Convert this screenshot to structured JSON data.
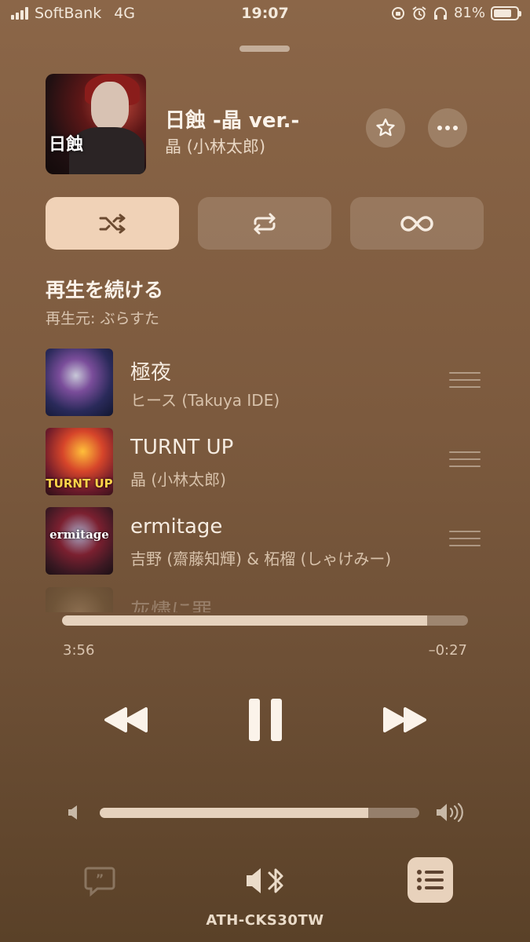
{
  "status_bar": {
    "carrier": "SoftBank",
    "network": "4G",
    "time": "19:07",
    "battery": "81%",
    "battery_level": 0.81
  },
  "now_playing": {
    "art_text": "日蝕",
    "title": "日蝕 -晶 ver.-",
    "artist": "晶 (小林太郎)"
  },
  "modes": {
    "shuffle_active": true,
    "repeat_active": false,
    "autoplay_active": false
  },
  "queue": {
    "heading": "再生を続ける",
    "source": "再生元: ぶらすた",
    "items": [
      {
        "title": "極夜",
        "artist": "ヒース (Takuya IDE)",
        "art_text": ""
      },
      {
        "title": "TURNT UP",
        "artist": "晶 (小林太郎)",
        "art_text": "TURNT UP"
      },
      {
        "title": "ermitage",
        "artist": "吉野 (齋藤知輝) & 柘榴 (しゃけみー)",
        "art_text": "ermitage"
      },
      {
        "title": "灰燼に罪",
        "artist": "",
        "art_text": ""
      }
    ]
  },
  "playback": {
    "elapsed": "3:56",
    "remaining": "–0:27",
    "progress": 0.9
  },
  "volume": {
    "level": 0.84
  },
  "output": {
    "device": "ATH-CKS30TW"
  },
  "colors": {
    "accent_button": "#f0d2b7",
    "text": "#f3e9dc"
  }
}
